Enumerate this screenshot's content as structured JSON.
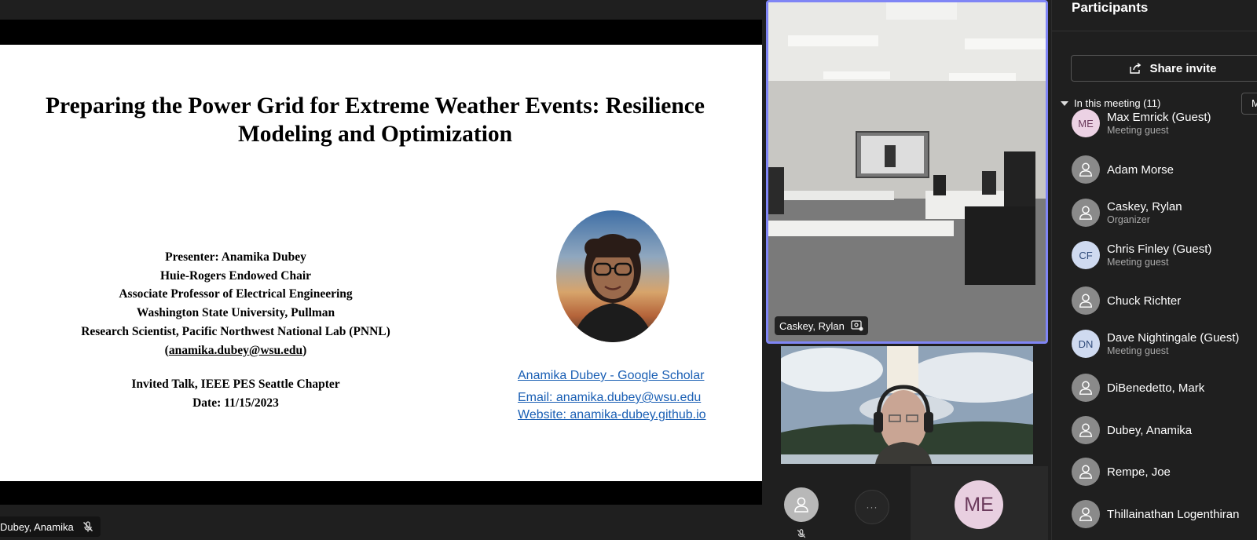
{
  "slide": {
    "title_line1": "Preparing the Power Grid for Extreme Weather Events: Resilience",
    "title_line2": "Modeling and Optimization",
    "presenter_lines": [
      "Presenter: Anamika Dubey",
      "Huie-Rogers Endowed Chair",
      "Associate Professor of Electrical Engineering",
      "Washington State University, Pullman",
      "Research Scientist, Pacific Northwest National Lab (PNNL)"
    ],
    "email_paren_open": "(",
    "email": "anamika.dubey@wsu.edu",
    "email_paren_close": ")",
    "talk_line": "Invited Talk, IEEE PES Seattle Chapter",
    "date_line": "Date: 11/15/2023",
    "links": {
      "scholar": "Anamika Dubey - Google Scholar",
      "email": "Email: anamika.dubey@wsu.edu",
      "website": "Website: anamika-dubey.github.io"
    }
  },
  "presenter_tag": {
    "name": "Dubey, Anamika",
    "mic_icon": "mic-off-icon"
  },
  "room_tile": {
    "name": "Caskey, Rylan",
    "status_icon": "room-device-icon"
  },
  "me_tile": {
    "initials": "ME"
  },
  "overflow": {
    "label": "···"
  },
  "panel": {
    "title": "Participants",
    "share_invite": "Share invite",
    "in_meeting": "In this meeting (11)",
    "mute_all_label": "M",
    "participants": [
      {
        "avatar": "initials",
        "initials": "ME",
        "color": "pink",
        "name": "Max Emrick (Guest)",
        "sub": "Meeting guest"
      },
      {
        "avatar": "generic",
        "name": "Adam Morse",
        "sub": ""
      },
      {
        "avatar": "generic",
        "name": "Caskey, Rylan",
        "sub": "Organizer"
      },
      {
        "avatar": "initials",
        "initials": "CF",
        "color": "blue",
        "name": "Chris Finley (Guest)",
        "sub": "Meeting guest"
      },
      {
        "avatar": "generic",
        "name": "Chuck Richter",
        "sub": ""
      },
      {
        "avatar": "initials",
        "initials": "DN",
        "color": "blue",
        "name": "Dave Nightingale (Guest)",
        "sub": "Meeting guest"
      },
      {
        "avatar": "generic",
        "name": "DiBenedetto, Mark",
        "sub": ""
      },
      {
        "avatar": "generic",
        "name": "Dubey, Anamika",
        "sub": ""
      },
      {
        "avatar": "generic",
        "name": "Rempe, Joe",
        "sub": ""
      },
      {
        "avatar": "generic",
        "name": "Thillainathan Logenthiran",
        "sub": ""
      }
    ]
  },
  "colors": {
    "accent": "#7f85f5",
    "link": "#1a5fb4",
    "background": "#1f1f1f"
  }
}
